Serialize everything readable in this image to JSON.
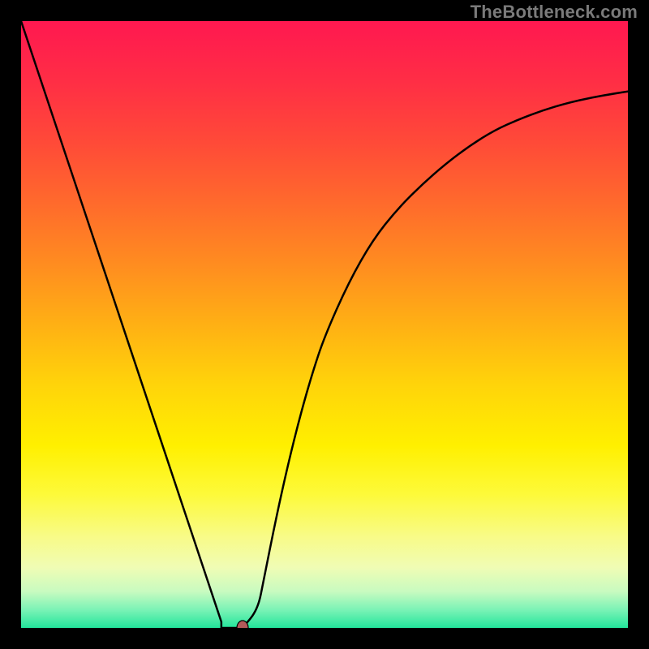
{
  "watermark": "TheBottleneck.com",
  "chart_data": {
    "type": "line",
    "title": "",
    "xlabel": "",
    "ylabel": "",
    "xlim": [
      0,
      1
    ],
    "ylim": [
      0,
      1
    ],
    "grid": false,
    "legend": false,
    "gradient_stops": [
      {
        "offset": 0.0,
        "color": "#ff1850"
      },
      {
        "offset": 0.1,
        "color": "#ff2e45"
      },
      {
        "offset": 0.2,
        "color": "#ff4a38"
      },
      {
        "offset": 0.3,
        "color": "#ff6a2c"
      },
      {
        "offset": 0.4,
        "color": "#ff8c20"
      },
      {
        "offset": 0.5,
        "color": "#ffb014"
      },
      {
        "offset": 0.6,
        "color": "#ffd40a"
      },
      {
        "offset": 0.7,
        "color": "#fff000"
      },
      {
        "offset": 0.78,
        "color": "#fdfa3a"
      },
      {
        "offset": 0.85,
        "color": "#f8fb88"
      },
      {
        "offset": 0.9,
        "color": "#f0fcb4"
      },
      {
        "offset": 0.94,
        "color": "#c8fbc0"
      },
      {
        "offset": 0.97,
        "color": "#7bf3b6"
      },
      {
        "offset": 1.0,
        "color": "#22e59b"
      }
    ],
    "series": [
      {
        "name": "bottleneck-curve",
        "x": [
          0.0,
          0.02,
          0.04,
          0.06,
          0.08,
          0.1,
          0.12,
          0.14,
          0.16,
          0.18,
          0.2,
          0.22,
          0.24,
          0.26,
          0.28,
          0.3,
          0.32,
          0.33,
          0.34,
          0.35,
          0.365,
          0.39,
          0.4,
          0.42,
          0.44,
          0.46,
          0.48,
          0.5,
          0.54,
          0.58,
          0.62,
          0.66,
          0.7,
          0.74,
          0.78,
          0.82,
          0.86,
          0.9,
          0.94,
          0.98,
          1.0
        ],
        "y": [
          1.0,
          0.94,
          0.88,
          0.82,
          0.76,
          0.7,
          0.64,
          0.58,
          0.52,
          0.46,
          0.4,
          0.34,
          0.28,
          0.22,
          0.16,
          0.1,
          0.04,
          0.01,
          0.0,
          0.0,
          0.0,
          0.03,
          0.08,
          0.18,
          0.27,
          0.35,
          0.42,
          0.48,
          0.57,
          0.64,
          0.69,
          0.73,
          0.765,
          0.795,
          0.82,
          0.838,
          0.853,
          0.865,
          0.874,
          0.881,
          0.884
        ]
      }
    ],
    "flat_segment": {
      "x0": 0.33,
      "x1": 0.365,
      "y": 0.0
    },
    "marker": {
      "x": 0.365,
      "y": 0.0,
      "rx": 7,
      "ry": 9,
      "color": "#b25a5a"
    }
  }
}
